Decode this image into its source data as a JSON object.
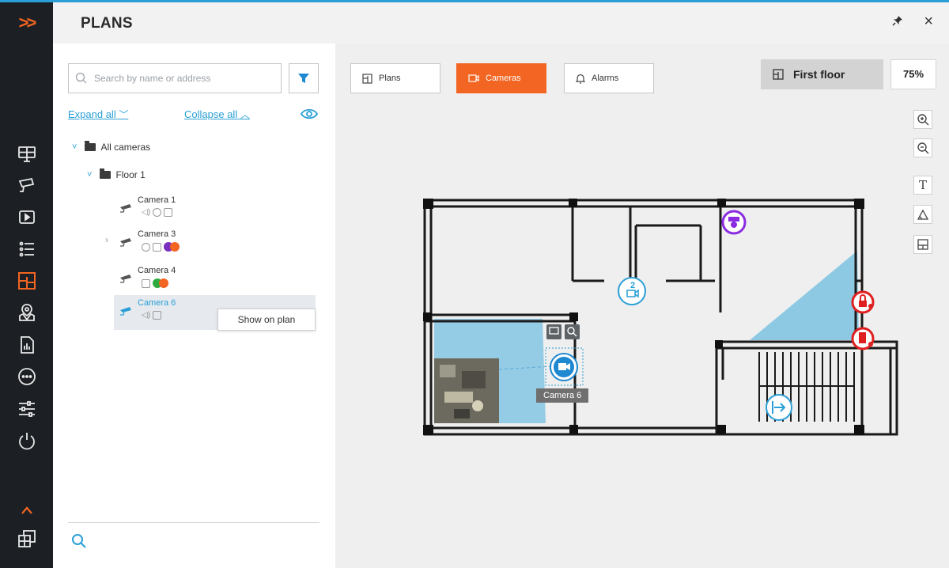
{
  "header": {
    "title": "PLANS",
    "pin_icon": "pin-icon",
    "close_label": "×"
  },
  "rail": {
    "expand_label": ">>",
    "items": [
      "monitor-icon",
      "camera-icon",
      "archive-icon",
      "list-icon",
      "plans-icon",
      "map-icon",
      "report-icon",
      "more-icon",
      "settings-icon",
      "power-icon"
    ],
    "active": "plans-icon",
    "bottom": [
      "chevron-up-icon",
      "windows-icon"
    ]
  },
  "search": {
    "placeholder": "Search by name or address"
  },
  "tree": {
    "expand_all": "Expand all",
    "collapse_all": "Collapse all",
    "root": "All cameras",
    "floor": "Floor 1",
    "cameras": [
      {
        "name": "Camera 1"
      },
      {
        "name": "Camera 3"
      },
      {
        "name": "Camera 4"
      },
      {
        "name": "Camera 6",
        "selected": true
      }
    ],
    "context_button": "Show on plan"
  },
  "tabs": [
    {
      "label": "Plans",
      "active": false
    },
    {
      "label": "Cameras",
      "active": true
    },
    {
      "label": "Alarms",
      "active": false
    }
  ],
  "plan": {
    "floor_name": "First floor",
    "zoom": "75%",
    "camera_label": "Camera 6",
    "camera_group_count": "2"
  },
  "tools": [
    "zoom-in-icon",
    "zoom-out-icon",
    "text-tool-icon",
    "shape-tool-icon",
    "grid-tool-icon"
  ],
  "colors": {
    "accent": "#f26522",
    "link": "#2a9fd6",
    "fov": "#8ec9e4",
    "alarm": "#e02020",
    "ptz": "#8a2be2"
  }
}
